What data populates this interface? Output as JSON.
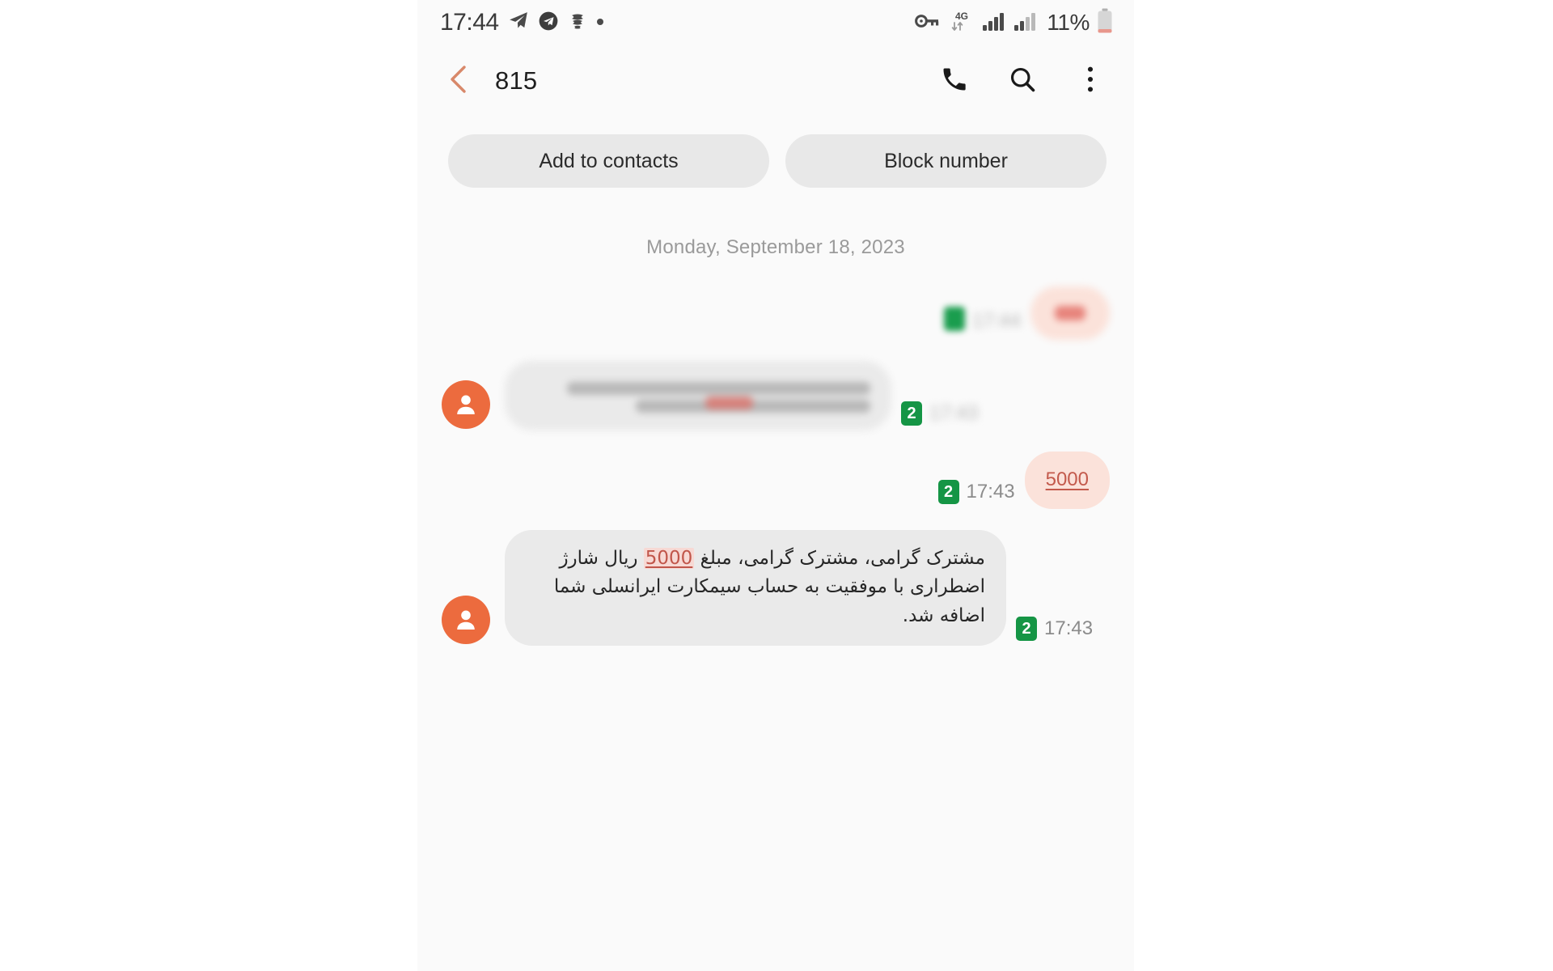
{
  "statusbar": {
    "clock": "17:44",
    "left_icons": [
      "telegram-plane-icon",
      "telegram-circle-icon",
      "app-icon",
      "dot-icon"
    ],
    "network_type": "4G",
    "battery_percent": "11%",
    "right_icons": [
      "vpn-key-icon",
      "data-transfer-icon",
      "signal-bars-1-icon",
      "signal-bars-2-icon",
      "battery-icon"
    ]
  },
  "appbar": {
    "back_icon": "chevron-left-icon",
    "title": "815",
    "actions": [
      {
        "name": "call-button",
        "icon": "phone-icon"
      },
      {
        "name": "search-button",
        "icon": "search-icon"
      },
      {
        "name": "more-options-button",
        "icon": "kebab-menu-icon"
      }
    ]
  },
  "quick_actions": {
    "add_to_contacts": "Add to contacts",
    "block_number": "Block number"
  },
  "thread": {
    "date_divider": "Monday, September 18, 2023",
    "messages": [
      {
        "id": "msg-1",
        "direction": "outgoing",
        "redacted": true,
        "text": "",
        "sim_badge": "",
        "time": "",
        "time_redacted": true,
        "bubble_color": "#fbe2da"
      },
      {
        "id": "msg-2",
        "direction": "incoming",
        "redacted": true,
        "text": "",
        "sim_badge": "2",
        "time": "",
        "time_redacted": true,
        "bubble_color": "#eaeaea"
      },
      {
        "id": "msg-3",
        "direction": "outgoing",
        "redacted": false,
        "text": "5000",
        "sim_badge": "2",
        "time": "17:43",
        "time_redacted": false,
        "bubble_color": "#fbe2da"
      },
      {
        "id": "msg-4",
        "direction": "incoming",
        "redacted": false,
        "text_before": "مشترک گرامی، مشترک گرامی، مبلغ ",
        "text_amount": "5000",
        "text_after": " ریال شارژ اضطراری با موفقیت به حساب سیمکارت ایرانسلی شما اضافه شد.",
        "sim_badge": "2",
        "time": "17:43",
        "time_redacted": false,
        "bubble_color": "#eaeaea"
      }
    ]
  },
  "colors": {
    "accent_orange": "#ec6b3e",
    "outgoing_bubble": "#fbe2da",
    "incoming_bubble": "#eaeaea",
    "sim_badge_green": "#159545",
    "amount_red": "#c1564a",
    "screen_bg": "#fafafa"
  }
}
